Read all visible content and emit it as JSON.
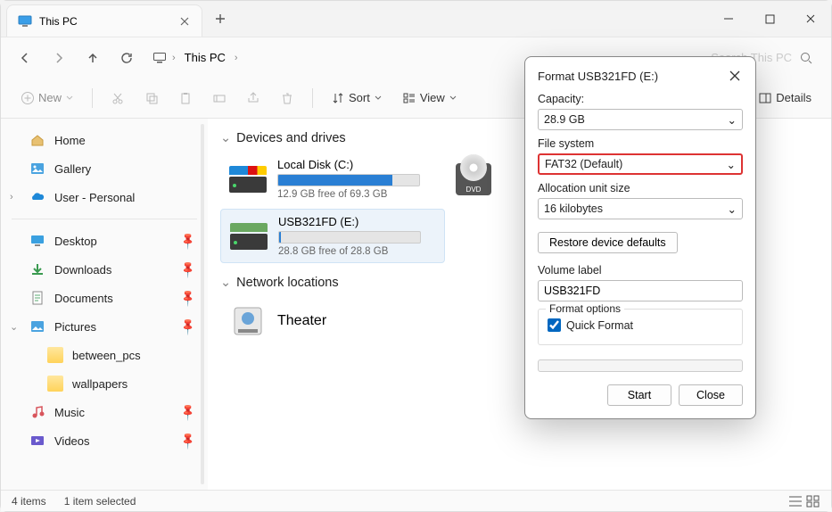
{
  "window": {
    "title": "This PC"
  },
  "breadcrumb": {
    "item": "This PC"
  },
  "search": {
    "placeholder": "Search This PC"
  },
  "toolbar": {
    "new": "New",
    "sort": "Sort",
    "view": "View",
    "details": "Details"
  },
  "sidebar": {
    "home": "Home",
    "gallery": "Gallery",
    "user": "User - Personal",
    "desktop": "Desktop",
    "downloads": "Downloads",
    "documents": "Documents",
    "pictures": "Pictures",
    "between": "between_pcs",
    "wallpapers": "wallpapers",
    "music": "Music",
    "videos": "Videos"
  },
  "main": {
    "devices_hdr": "Devices and drives",
    "network_hdr": "Network locations",
    "drive_c": {
      "name": "Local Disk (C:)",
      "free": "12.9 GB free of 69.3 GB",
      "fill_pct": 81
    },
    "drive_e": {
      "name": "USB321FD (E:)",
      "free": "28.8 GB free of 28.8 GB",
      "fill_pct": 1
    },
    "dvd_label": "DVD",
    "theater": "Theater"
  },
  "status": {
    "items": "4 items",
    "selected": "1 item selected"
  },
  "dialog": {
    "title": "Format USB321FD (E:)",
    "capacity_lbl": "Capacity:",
    "capacity_val": "28.9 GB",
    "fs_lbl": "File system",
    "fs_val": "FAT32 (Default)",
    "aus_lbl": "Allocation unit size",
    "aus_val": "16 kilobytes",
    "restore": "Restore device defaults",
    "vol_lbl": "Volume label",
    "vol_val": "USB321FD",
    "opts_lbl": "Format options",
    "quick": "Quick Format",
    "start": "Start",
    "close": "Close"
  }
}
